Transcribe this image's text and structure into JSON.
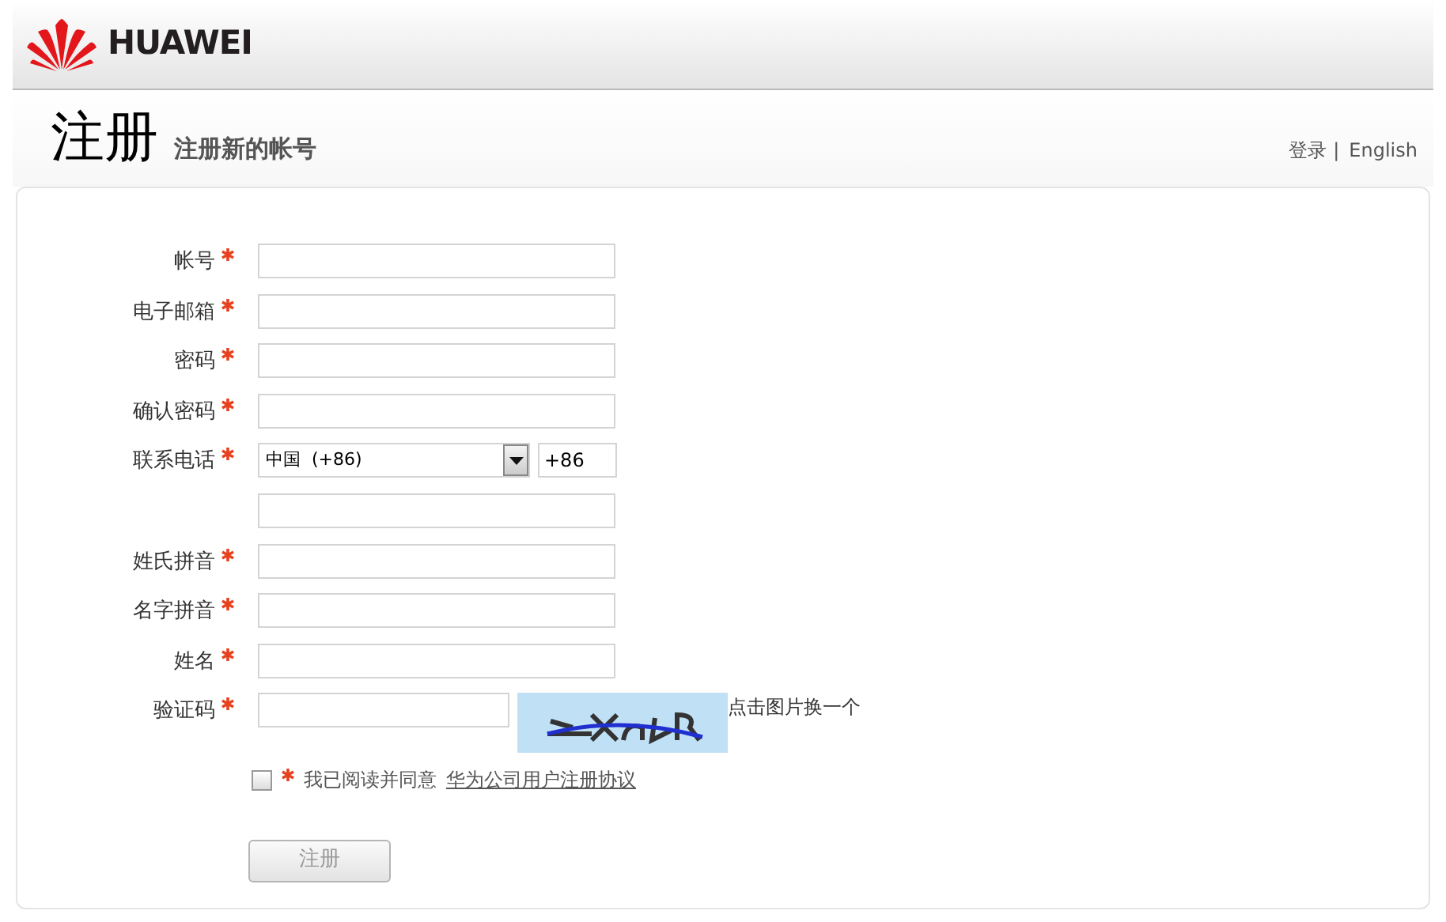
{
  "header": {
    "logo_text": "HUAWEI"
  },
  "title": {
    "main": "注册",
    "subtitle": "注册新的帐号"
  },
  "top_links": [
    {
      "label": "登录",
      "separator": "|"
    },
    {
      "label": "English"
    }
  ],
  "form": {
    "fields": [
      {
        "kind": "text",
        "label": "帐号",
        "required": true
      },
      {
        "kind": "text",
        "label": "电子邮箱",
        "required": true
      },
      {
        "kind": "text",
        "label": "密码",
        "required": true
      },
      {
        "kind": "text",
        "label": "确认密码",
        "required": true
      },
      {
        "kind": "phone",
        "label": "联系电话",
        "required": true,
        "country": "中国  (+86)",
        "code": "+86"
      },
      {
        "kind": "text"
      },
      {
        "kind": "text",
        "label": "姓氏拼音",
        "required": true
      },
      {
        "kind": "text",
        "label": "名字拼音",
        "required": true
      },
      {
        "kind": "text",
        "label": "姓名",
        "required": true
      },
      {
        "kind": "captcha",
        "label": "验证码",
        "required": true,
        "hint": "点击图片换一个"
      }
    ],
    "agreement": {
      "checked": false,
      "required": true,
      "text": "我已阅读并同意",
      "link": "华为公司用户注册协议"
    },
    "submit": {
      "label": "注册",
      "disabled": true
    }
  }
}
